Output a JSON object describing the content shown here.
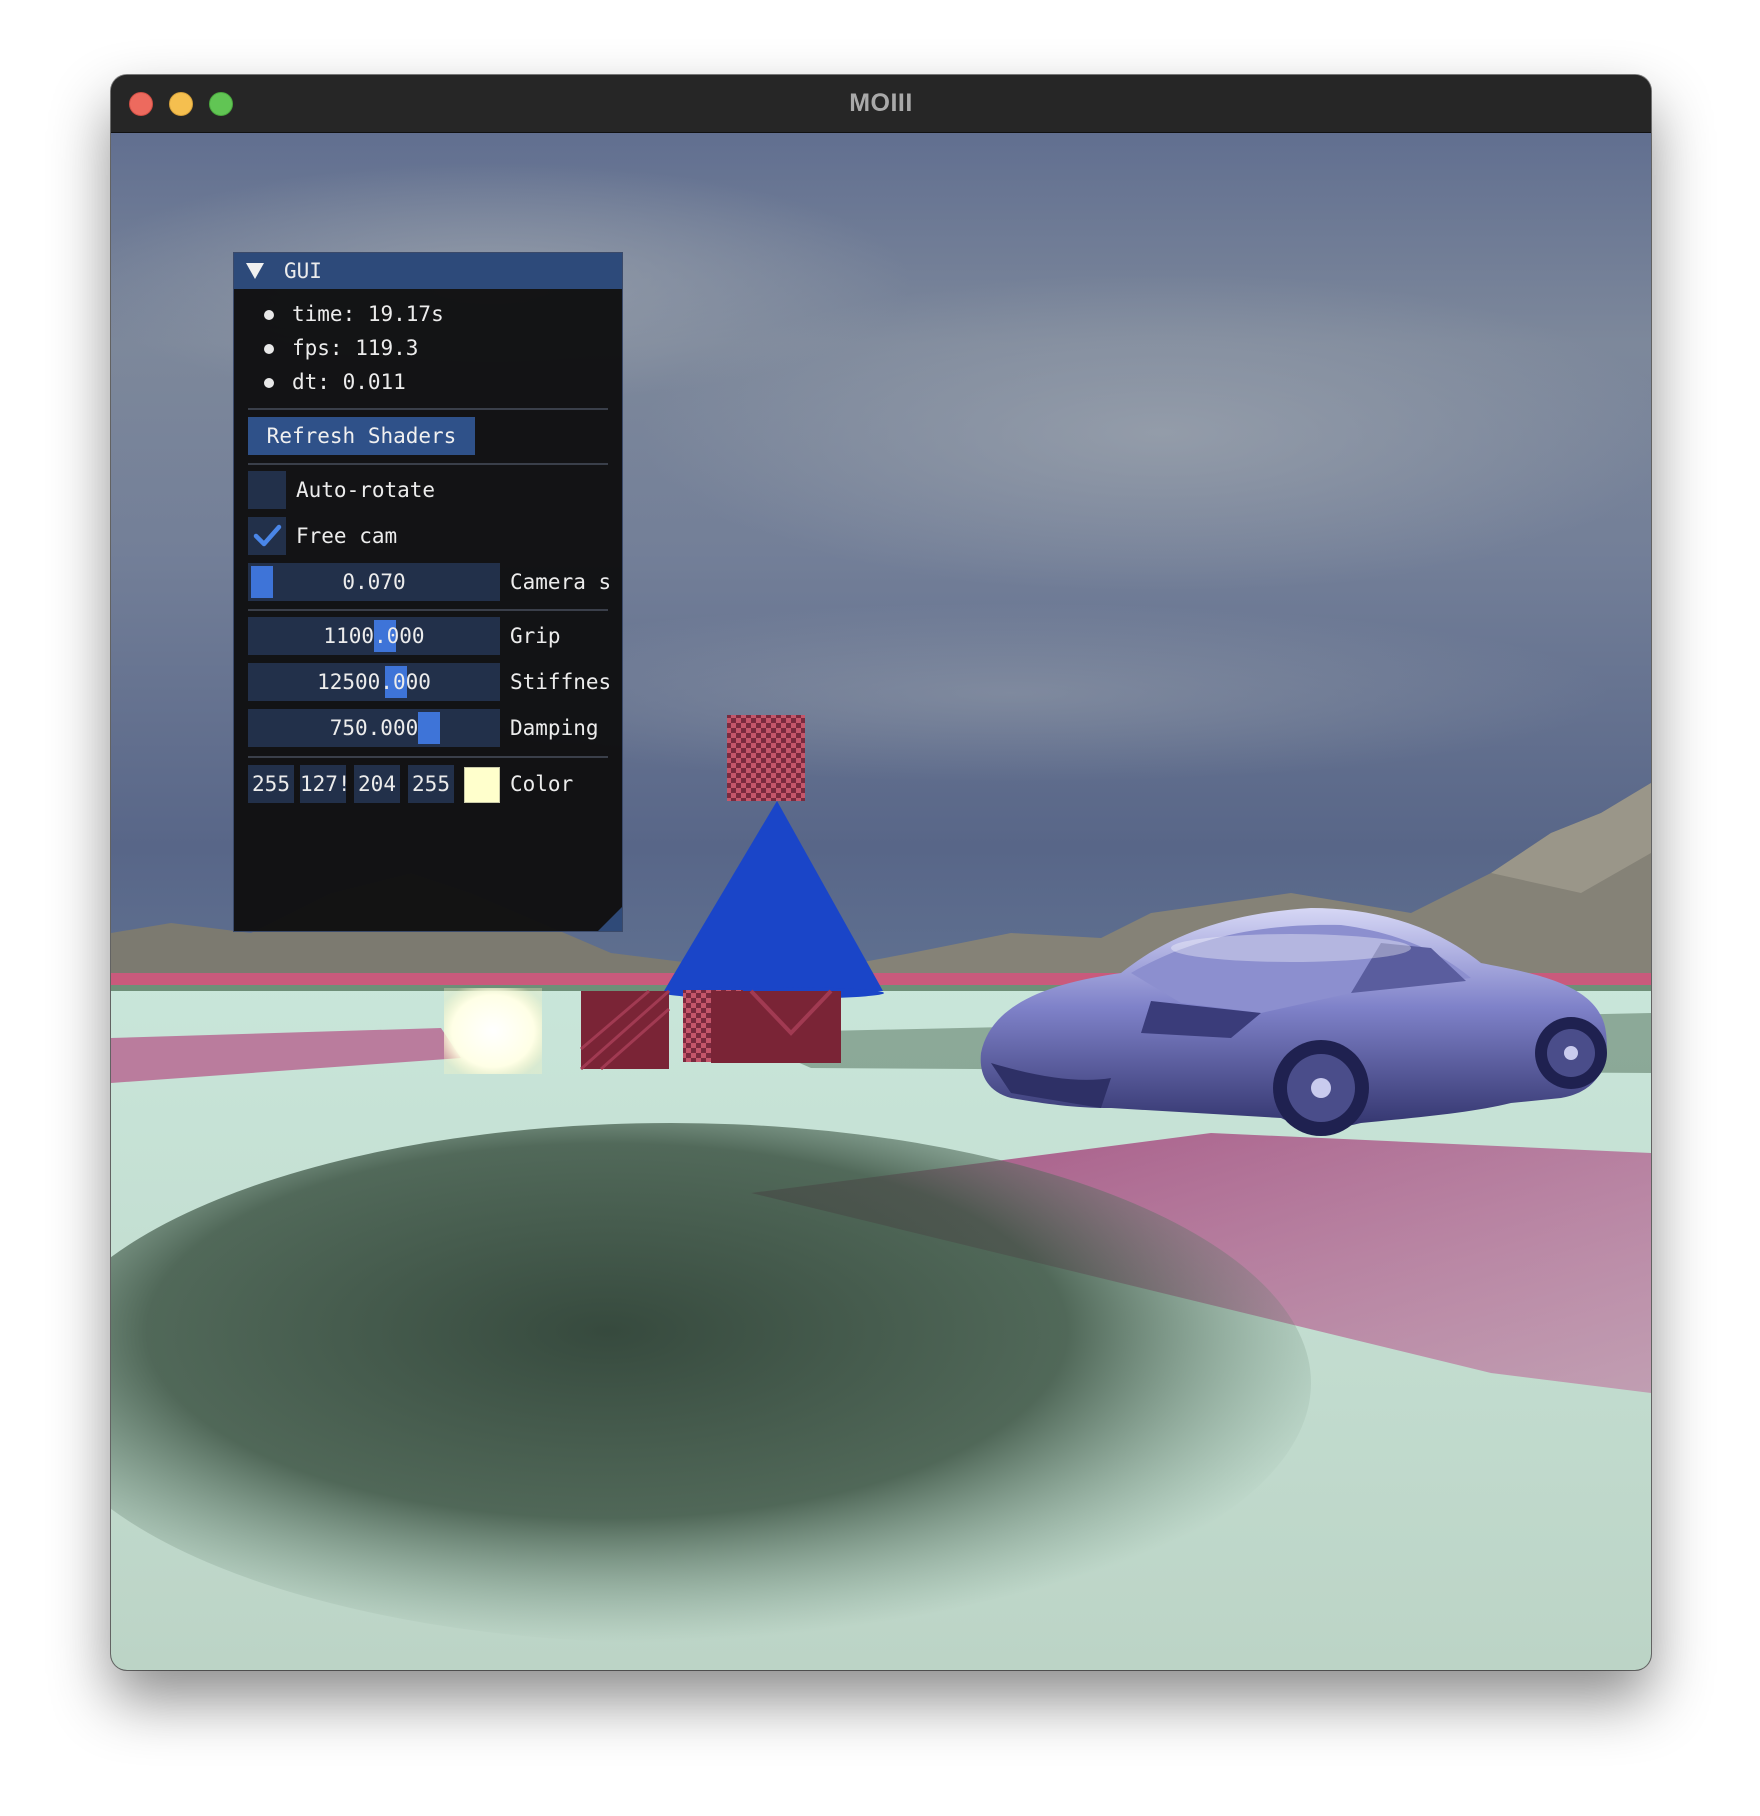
{
  "window": {
    "title": "MOIII"
  },
  "gui": {
    "header": "GUI",
    "stats": [
      {
        "text": "time: 19.17s"
      },
      {
        "text": "fps: 119.3"
      },
      {
        "text": "dt: 0.011"
      }
    ],
    "refresh_button": "Refresh Shaders",
    "auto_rotate": {
      "label": "Auto-rotate",
      "checked": false
    },
    "free_cam": {
      "label": "Free cam",
      "checked": true
    },
    "camera_speed": {
      "value": "0.070",
      "label": "Camera s",
      "fill": 0.07
    },
    "grip": {
      "value": "1100.000",
      "label": "Grip"
    },
    "stiffness": {
      "value": "12500.000",
      "label": "Stiffnes"
    },
    "damping": {
      "value": "750.000",
      "label": "Damping"
    },
    "color": {
      "r": "255",
      "g": "127!",
      "b": "204",
      "a": "255",
      "label": "Color",
      "swatch": "#ffffcc"
    }
  },
  "colors": {
    "gui_header": "#2d4a7a",
    "gui_accent": "#3e74d8",
    "pyramid": "#1a45c8",
    "car_body": "#6c6fb8"
  }
}
